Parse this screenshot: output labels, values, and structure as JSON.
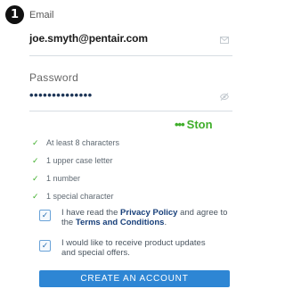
{
  "step": {
    "number": "1"
  },
  "email": {
    "label": "Email",
    "value": "joe.smyth@pentair.com",
    "icon": "envelope-icon"
  },
  "password": {
    "label": "Password",
    "value": "••••••••••••••",
    "icon": "eye-icon"
  },
  "strength": {
    "dots": "•••",
    "label": "Ston",
    "color": "#3fae2a"
  },
  "requirements": [
    "At least 8 characters",
    "1 upper case letter",
    "1 number",
    "1 special character"
  ],
  "consent": {
    "terms": {
      "pre": "I have read the ",
      "privacy_link": "Privacy Policy",
      "mid": " and agree to the ",
      "terms_link": "Terms and Conditions",
      "post": ".",
      "checked": true
    },
    "marketing": {
      "text": "I would like to receive product updates and special offers.",
      "checked": true
    }
  },
  "cta": {
    "label": "CREATE AN ACCOUNT",
    "color": "#2e86d4"
  }
}
